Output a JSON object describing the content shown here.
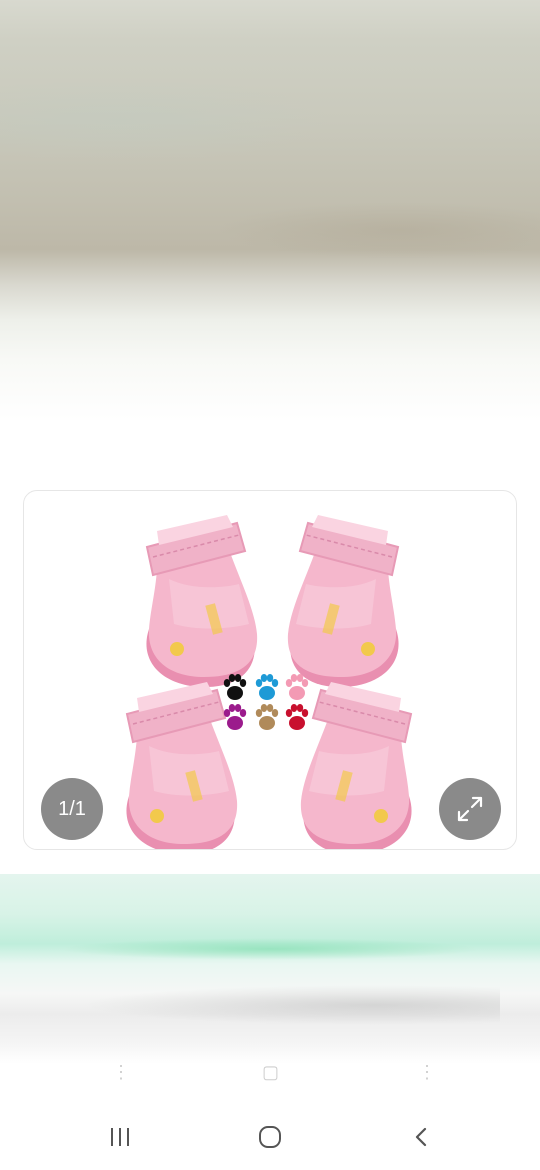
{
  "viewer": {
    "image_counter": "1/1",
    "expand_icon": "expand-arrows-icon",
    "product_image": "pink-dog-boots-photo"
  },
  "navbar": {
    "recents_icon": "recents-icon",
    "home_icon": "home-icon",
    "back_icon": "back-icon"
  },
  "colors": {
    "boot_pink": "#f2a9c4",
    "overlay_gray": "#8a8a8a",
    "paw_colors": [
      "#111111",
      "#1e9ad6",
      "#f39ab4",
      "#9b1b8c",
      "#b08a5a",
      "#c8102e"
    ]
  }
}
